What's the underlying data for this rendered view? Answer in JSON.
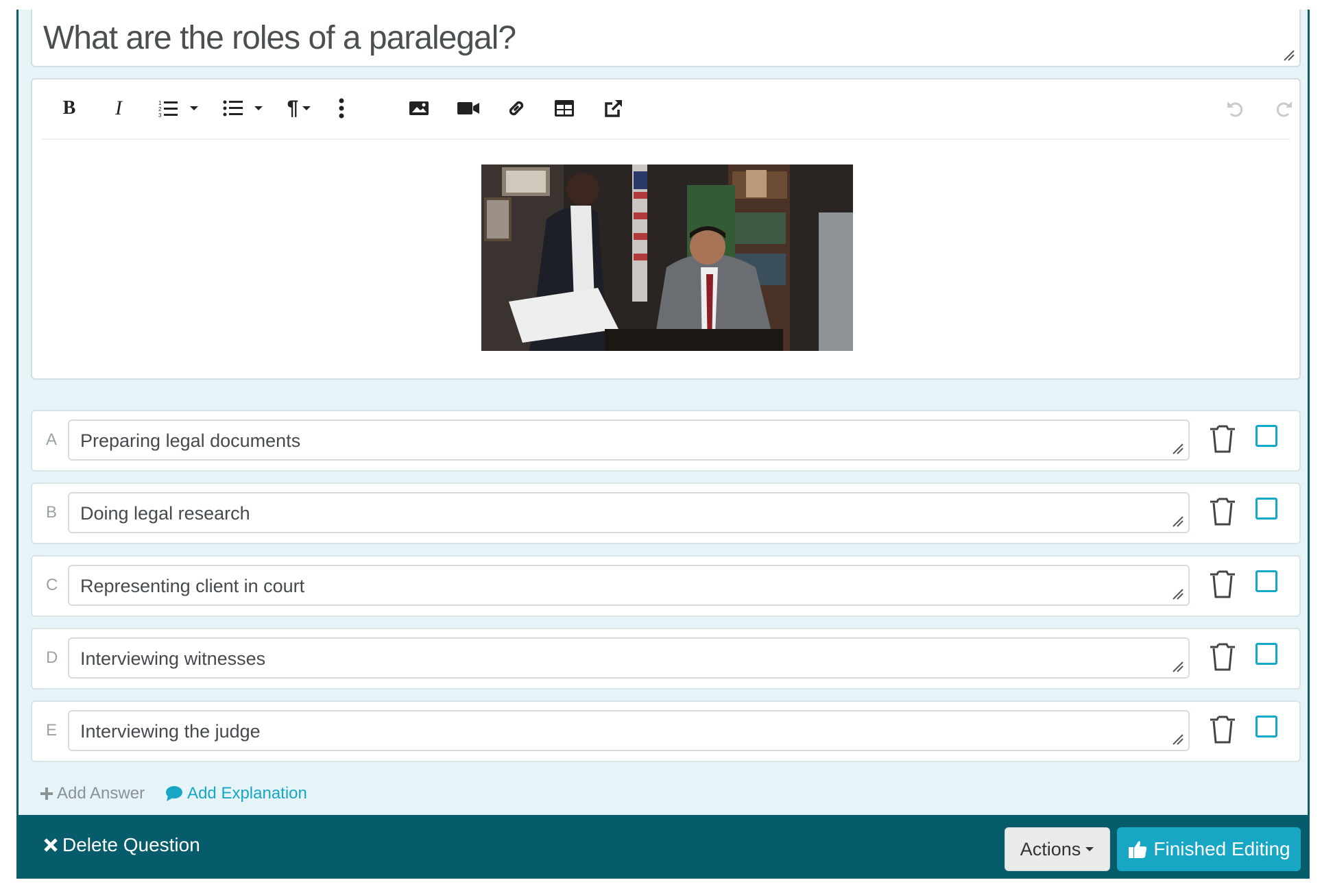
{
  "question": {
    "text": "What are the roles of a paralegal?"
  },
  "toolbar": {
    "icons": [
      "bold-icon",
      "italic-icon",
      "ordered-list-icon",
      "bullet-list-icon",
      "paragraph-icon",
      "more-vertical-icon",
      "image-icon",
      "video-icon",
      "link-icon",
      "table-icon",
      "external-link-icon",
      "undo-icon",
      "redo-icon"
    ],
    "bold_label": "B",
    "italic_label": "I"
  },
  "answers": [
    {
      "letter": "A",
      "text": "Preparing legal documents"
    },
    {
      "letter": "B",
      "text": "Doing legal research"
    },
    {
      "letter": "C",
      "text": "Representing client in court"
    },
    {
      "letter": "D",
      "text": "Interviewing witnesses"
    },
    {
      "letter": "E",
      "text": "Interviewing the judge"
    }
  ],
  "links": {
    "add_answer": "Add Answer",
    "add_explanation": "Add Explanation"
  },
  "footer": {
    "delete_label": "Delete Question",
    "actions_label": "Actions",
    "finished_label": "Finished Editing"
  },
  "colors": {
    "accent": "#17a6c4",
    "footer_bg": "#075c6b",
    "card_bg": "#e6f4f8",
    "checkbox_border": "#12a9c9"
  }
}
